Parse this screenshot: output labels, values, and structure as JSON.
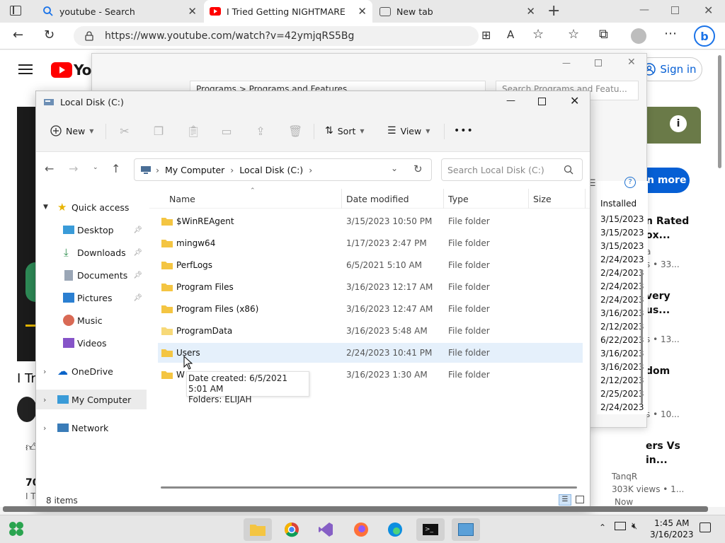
{
  "browser": {
    "tabs": [
      {
        "title": "youtube - Search"
      },
      {
        "title": "I Tried Getting NIGHTMARE RAN"
      },
      {
        "title": "New tab"
      }
    ],
    "url": "https://www.youtube.com/watch?v=42ymjqRS5Bg"
  },
  "youtube": {
    "sign_in": "Sign in",
    "logo_text": "You",
    "learn_more": "n more",
    "video_title_fragment": "I Tr",
    "rec_items": [
      {
        "line1": "n Rated",
        "line2": "ox...",
        "meta": "a",
        "meta2": "s • 33..."
      },
      {
        "line1": "very",
        "line2": "us...",
        "meta": "s • 13..."
      },
      {
        "line1": "dom",
        "meta": "s • 10..."
      },
      {
        "line1": "ers Vs",
        "line2": "in...",
        "channel": "TanqR",
        "views": "303K views • 1...",
        "extra": "Now"
      }
    ],
    "left_fragments": [
      "70",
      "I T"
    ]
  },
  "programs_and_features": {
    "breadcrumb": "Programs  >  Programs and Features",
    "search_placeholder": "Search Programs and Featu...",
    "col_header": "Installed",
    "dates": [
      "3/15/2023",
      "3/15/2023",
      "3/15/2023",
      "2/24/2023",
      "2/24/2023",
      "2/24/2023",
      "2/24/2023",
      "3/16/2023",
      "2/12/2023",
      "6/22/2023",
      "3/16/2023",
      "3/16/2023",
      "2/12/2023",
      "2/25/2023",
      "2/24/2023"
    ]
  },
  "explorer": {
    "title": "Local Disk (C:)",
    "toolbar": {
      "new": "New",
      "sort": "Sort",
      "view": "View",
      "more": "•••"
    },
    "breadcrumb": [
      "My Computer",
      "Local Disk (C:)"
    ],
    "search_placeholder": "Search Local Disk (C:)",
    "sidebar": [
      {
        "label": "Quick access",
        "kind": "section"
      },
      {
        "label": "Desktop",
        "pinned": true
      },
      {
        "label": "Downloads",
        "pinned": true
      },
      {
        "label": "Documents",
        "pinned": true
      },
      {
        "label": "Pictures",
        "pinned": true
      },
      {
        "label": "Music"
      },
      {
        "label": "Videos"
      },
      {
        "label": "OneDrive",
        "kind": "section"
      },
      {
        "label": "My Computer",
        "kind": "section",
        "selected": true
      },
      {
        "label": "Network",
        "kind": "section"
      }
    ],
    "columns": {
      "name": "Name",
      "date": "Date modified",
      "type": "Type",
      "size": "Size"
    },
    "files": [
      {
        "name": "$WinREAgent",
        "date": "3/15/2023 10:50 PM",
        "type": "File folder"
      },
      {
        "name": "mingw64",
        "date": "1/17/2023 2:47 PM",
        "type": "File folder"
      },
      {
        "name": "PerfLogs",
        "date": "6/5/2021 5:10 AM",
        "type": "File folder"
      },
      {
        "name": "Program Files",
        "date": "3/16/2023 12:17 AM",
        "type": "File folder"
      },
      {
        "name": "Program Files (x86)",
        "date": "3/16/2023 12:47 AM",
        "type": "File folder"
      },
      {
        "name": "ProgramData",
        "date": "3/16/2023 5:48 AM",
        "type": "File folder"
      },
      {
        "name": "Users",
        "date": "2/24/2023 10:41 PM",
        "type": "File folder"
      },
      {
        "name": "W",
        "date": "3/16/2023 1:30 AM",
        "type": "File folder"
      }
    ],
    "tooltip": {
      "line1": "Date created: 6/5/2021 5:01 AM",
      "line2": "Folders: ELIJAH"
    },
    "status": "8 items"
  },
  "taskbar": {
    "time": "1:45 AM",
    "date": "3/16/2023"
  },
  "colors": {
    "accent": "#0067c0",
    "folder": "#f4c542",
    "yt_red": "#ff0000",
    "hover_row": "#e5f0fb"
  }
}
